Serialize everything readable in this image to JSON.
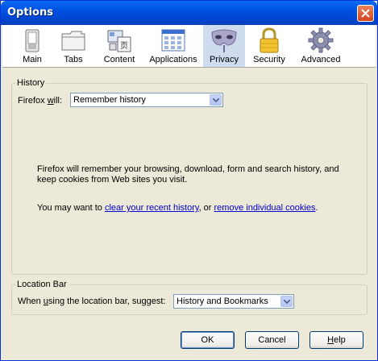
{
  "window": {
    "title": "Options"
  },
  "toolbar": {
    "tabs": [
      {
        "label": "Main",
        "icon": "switch-icon"
      },
      {
        "label": "Tabs",
        "icon": "tabs-icon"
      },
      {
        "label": "Content",
        "icon": "content-icon"
      },
      {
        "label": "Applications",
        "icon": "applications-icon"
      },
      {
        "label": "Privacy",
        "icon": "privacy-mask-icon",
        "selected": true
      },
      {
        "label": "Security",
        "icon": "padlock-icon"
      },
      {
        "label": "Advanced",
        "icon": "gear-icon"
      }
    ]
  },
  "history": {
    "title": "History",
    "firefox_will_label_pre": "Firefox ",
    "firefox_will_label_key": "w",
    "firefox_will_label_post": "ill:",
    "mode_value": "Remember history",
    "description_line1": "Firefox will remember your browsing, download, form and search history, and",
    "description_line2": "keep cookies from Web sites you visit.",
    "may_want_prefix": "You may want to ",
    "clear_link": "clear your recent history",
    "or_text": ", or ",
    "cookies_link": "remove individual cookies",
    "end_period": "."
  },
  "location_bar": {
    "title": "Location Bar",
    "suggest_label_pre": "When ",
    "suggest_label_key": "u",
    "suggest_label_post": "sing the location bar, suggest:",
    "suggest_value": "History and Bookmarks"
  },
  "buttons": {
    "ok": "OK",
    "cancel": "Cancel",
    "help_key": "H",
    "help_rest": "elp"
  },
  "colors": {
    "titlebar": "#0054e3",
    "dialog_bg": "#ece9d8",
    "selected_tab_bg": "#cfdcef",
    "link": "#0000cc"
  }
}
